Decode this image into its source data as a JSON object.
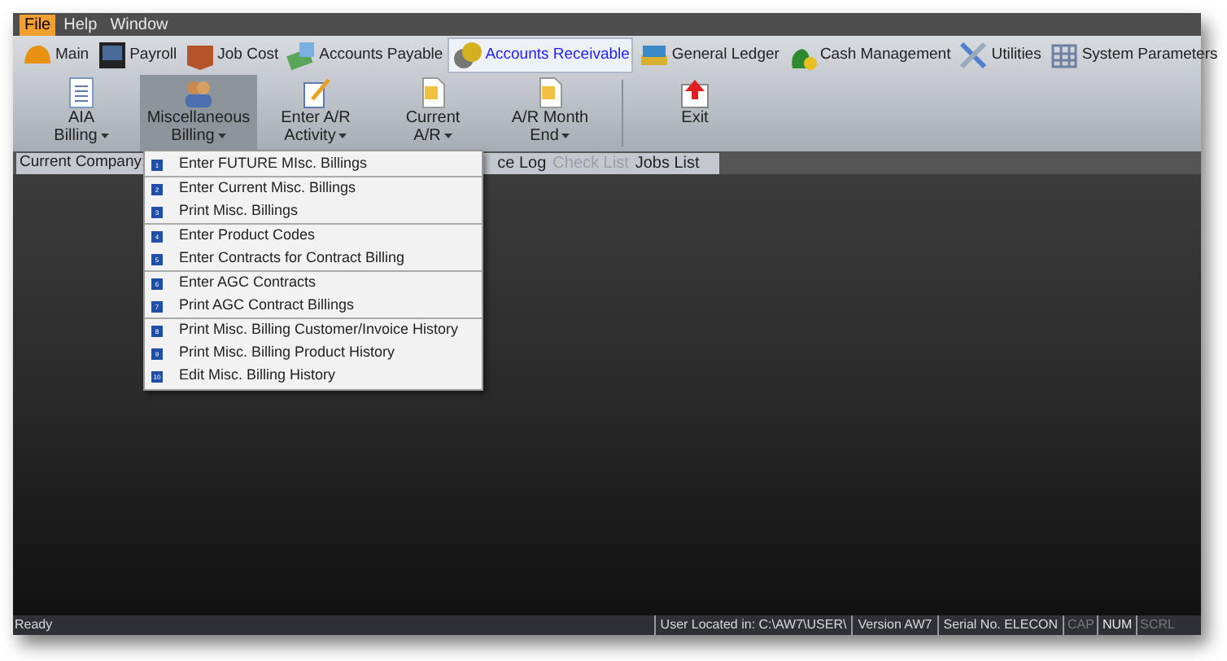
{
  "menu_bar": [
    {
      "label": "File",
      "selected": true
    },
    {
      "label": "Help",
      "selected": false
    },
    {
      "label": "Window",
      "selected": false
    }
  ],
  "modules": [
    {
      "label": "Main",
      "selected": false
    },
    {
      "label": "Payroll",
      "selected": false
    },
    {
      "label": "Job Cost",
      "selected": false
    },
    {
      "label": "Accounts Payable",
      "selected": false
    },
    {
      "label": "Accounts Receivable",
      "selected": true
    },
    {
      "label": "General Ledger",
      "selected": false
    },
    {
      "label": "Cash Management",
      "selected": false
    },
    {
      "label": "Utilities",
      "selected": false
    },
    {
      "label": "System Parameters",
      "selected": false
    }
  ],
  "ribbon": [
    {
      "lines": [
        "AIA",
        "Billing"
      ],
      "dropdown": true,
      "selected": false
    },
    {
      "lines": [
        "Miscellaneous",
        "Billing"
      ],
      "dropdown": true,
      "selected": true
    },
    {
      "lines": [
        "Enter A/R",
        "Activity"
      ],
      "dropdown": true,
      "selected": false
    },
    {
      "lines": [
        "Current",
        "A/R"
      ],
      "dropdown": true,
      "selected": false
    },
    {
      "lines": [
        "A/R Month",
        "End"
      ],
      "dropdown": true,
      "selected": false
    },
    {
      "lines": [
        "Exit"
      ],
      "dropdown": false,
      "selected": false
    }
  ],
  "toolbar": [
    {
      "label": "Current Company:",
      "disabled": false
    },
    {
      "label": "ce Log",
      "disabled": false
    },
    {
      "label": "Check List",
      "disabled": true
    },
    {
      "label": "Jobs List",
      "disabled": false
    }
  ],
  "dropdown_menu": [
    [
      {
        "number": "1",
        "label": "Enter FUTURE MIsc. Billings"
      }
    ],
    [
      {
        "number": "2",
        "label": "Enter Current Misc. Billings"
      },
      {
        "number": "3",
        "label": "Print Misc. Billings"
      }
    ],
    [
      {
        "number": "4",
        "label": "Enter Product Codes"
      },
      {
        "number": "5",
        "label": "Enter Contracts for Contract Billing"
      }
    ],
    [
      {
        "number": "6",
        "label": "Enter AGC Contracts"
      },
      {
        "number": "7",
        "label": "Print AGC Contract Billings"
      }
    ],
    [
      {
        "number": "8",
        "label": "Print Misc. Billing Customer/Invoice History"
      },
      {
        "number": "9",
        "label": "Print Misc. Billing Product History"
      },
      {
        "number": "10",
        "label": "Edit Misc. Billing History"
      }
    ]
  ],
  "status_bar": {
    "message": "Ready",
    "panels": [
      "User Located in: C:\\AW7\\USER\\",
      "Version AW7",
      "Serial No. ELECON"
    ],
    "indicators": [
      {
        "label": "CAP",
        "on": false
      },
      {
        "label": "NUM",
        "on": true
      },
      {
        "label": "SCRL",
        "on": false
      }
    ]
  }
}
